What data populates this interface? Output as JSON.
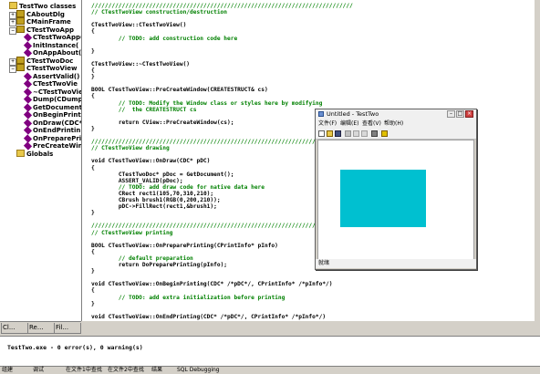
{
  "class_view": {
    "items": [
      {
        "label": "TestTwo classes",
        "icon": "folder-icon",
        "level": 0
      },
      {
        "label": "CAboutDlg",
        "icon": "class-icon",
        "level": 1
      },
      {
        "label": "CMainFrame",
        "icon": "class-icon",
        "level": 1
      },
      {
        "label": "CTestTwoApp",
        "icon": "class-icon",
        "level": 1
      },
      {
        "label": "CTestTwoApp(",
        "icon": "method-icon",
        "level": 2
      },
      {
        "label": "InitInstance(",
        "icon": "method-icon",
        "level": 2
      },
      {
        "label": "OnAppAbout(",
        "icon": "method-icon",
        "level": 2
      },
      {
        "label": "CTestTwoDoc",
        "icon": "class-icon",
        "level": 1
      },
      {
        "label": "CTestTwoView",
        "icon": "class-icon",
        "level": 1
      },
      {
        "label": "AssertValid()",
        "icon": "method-icon",
        "level": 2
      },
      {
        "label": "CTestTwoVie",
        "icon": "method-icon",
        "level": 2
      },
      {
        "label": "~CTestTwoVie",
        "icon": "method-icon",
        "level": 2
      },
      {
        "label": "Dump(CDump",
        "icon": "method-icon",
        "level": 2
      },
      {
        "label": "GetDocument(",
        "icon": "method-icon",
        "level": 2
      },
      {
        "label": "OnBeginPrinti",
        "icon": "method-icon",
        "level": 2
      },
      {
        "label": "OnDraw(CDC*",
        "icon": "method-icon",
        "level": 2
      },
      {
        "label": "OnEndPrintin",
        "icon": "method-icon",
        "level": 2
      },
      {
        "label": "OnPreparePrin",
        "icon": "method-icon",
        "level": 2
      },
      {
        "label": "PreCreateWin",
        "icon": "method-icon",
        "level": 2
      },
      {
        "label": "Globals",
        "icon": "folder-icon",
        "level": 1
      }
    ],
    "tabs": [
      "Cl...",
      "Re...",
      "Fil..."
    ]
  },
  "code_lines": [
    {
      "t": "/////////////////////////////////////////////////////////////////////////////",
      "c": "cmt"
    },
    {
      "t": "// CTestTwoView construction/destruction",
      "c": "cmt"
    },
    {
      "t": "",
      "c": ""
    },
    {
      "t": "CTestTwoView::CTestTwoView()",
      "c": ""
    },
    {
      "t": "{",
      "c": ""
    },
    {
      "t": "\t// TODO: add construction code here",
      "c": "cmt"
    },
    {
      "t": "",
      "c": ""
    },
    {
      "t": "}",
      "c": ""
    },
    {
      "t": "",
      "c": ""
    },
    {
      "t": "CTestTwoView::~CTestTwoView()",
      "c": ""
    },
    {
      "t": "{",
      "c": ""
    },
    {
      "t": "}",
      "c": ""
    },
    {
      "t": "",
      "c": ""
    },
    {
      "t": "BOOL CTestTwoView::PreCreateWindow(CREATESTRUCT& cs)",
      "c": ""
    },
    {
      "t": "{",
      "c": ""
    },
    {
      "t": "\t// TODO: Modify the Window class or styles here by modifying",
      "c": "cmt"
    },
    {
      "t": "\t//  the CREATESTRUCT cs",
      "c": "cmt"
    },
    {
      "t": "",
      "c": ""
    },
    {
      "t": "\treturn CView::PreCreateWindow(cs);",
      "c": "kwline"
    },
    {
      "t": "}",
      "c": ""
    },
    {
      "t": "",
      "c": ""
    },
    {
      "t": "/////////////////////////////////////////////////////////////////////////////",
      "c": "cmt"
    },
    {
      "t": "// CTestTwoView drawing",
      "c": "cmt"
    },
    {
      "t": "",
      "c": ""
    },
    {
      "t": "void CTestTwoView::OnDraw(CDC* pDC)",
      "c": "kwline"
    },
    {
      "t": "{",
      "c": ""
    },
    {
      "t": "\tCTestTwoDoc* pDoc = GetDocument();",
      "c": ""
    },
    {
      "t": "\tASSERT_VALID(pDoc);",
      "c": ""
    },
    {
      "t": "\t// TODO: add draw code for native data here",
      "c": "cmt"
    },
    {
      "t": "\tCRect rect1(105,70,310,210);",
      "c": ""
    },
    {
      "t": "\tCBrush brush1(RGB(0,200,210));",
      "c": ""
    },
    {
      "t": "\tpDC->FillRect(rect1,&brush1);",
      "c": ""
    },
    {
      "t": "}",
      "c": ""
    },
    {
      "t": "",
      "c": ""
    },
    {
      "t": "/////////////////////////////////////////////////////////////////////////////",
      "c": "cmt"
    },
    {
      "t": "// CTestTwoView printing",
      "c": "cmt"
    },
    {
      "t": "",
      "c": ""
    },
    {
      "t": "BOOL CTestTwoView::OnPreparePrinting(CPrintInfo* pInfo)",
      "c": ""
    },
    {
      "t": "{",
      "c": ""
    },
    {
      "t": "\t// default preparation",
      "c": "cmt"
    },
    {
      "t": "\treturn DoPreparePrinting(pInfo);",
      "c": "kwline"
    },
    {
      "t": "}",
      "c": ""
    },
    {
      "t": "",
      "c": ""
    },
    {
      "t": "void CTestTwoView::OnBeginPrinting(CDC* /*pDC*/, CPrintInfo* /*pInfo*/)",
      "c": "kwline"
    },
    {
      "t": "{",
      "c": ""
    },
    {
      "t": "\t// TODO: add extra initialization before printing",
      "c": "cmt"
    },
    {
      "t": "}",
      "c": ""
    },
    {
      "t": "",
      "c": ""
    },
    {
      "t": "void CTestTwoView::OnEndPrinting(CDC* /*pDC*/, CPrintInfo* /*pInfo*/)",
      "c": "kwline"
    }
  ],
  "output": {
    "text": "TestTwo.exe - 0 error(s), 0 warning(s)",
    "tabs": [
      "组建",
      "调试",
      "在文件1中查找",
      "在文件2中查找",
      "结果",
      "SQL Debugging"
    ]
  },
  "app_window": {
    "title": "Untitled - TestTwo",
    "menu": [
      "文件(F)",
      "编辑(E)",
      "查看(V)",
      "帮助(H)"
    ],
    "status": "就绪",
    "rect_color": "#00c0d0"
  }
}
